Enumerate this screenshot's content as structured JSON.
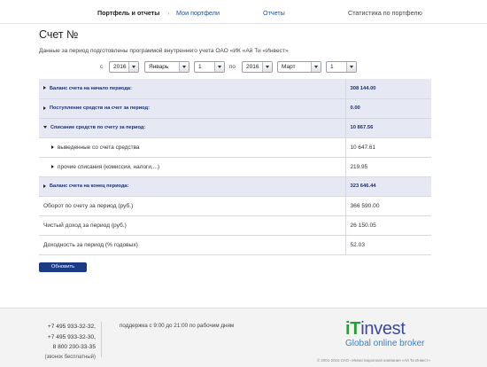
{
  "nav": {
    "active": "Портфель и отчеты",
    "separator": "›",
    "my_portfolios": "Мои портфели",
    "reports": "Отчеты",
    "stats": "Статистика по портфелю"
  },
  "page": {
    "title": "Счет №",
    "intro": "Данные за период подготовлены программой внутреннего учета ОАО «ИК «Ай Ти «Инвест»"
  },
  "period": {
    "from_label": "с",
    "to_label": "по",
    "from_year": "2016",
    "from_month": "Январь",
    "from_day": "1",
    "to_year": "2016",
    "to_month": "Март",
    "to_day": "1"
  },
  "report": {
    "rows": [
      {
        "label": "Баланс счета на начало периода:",
        "value": "308 144.00"
      },
      {
        "label": "Поступление средств на счет за период:",
        "value": "0.00"
      },
      {
        "label": "Списание средств по счету за период:",
        "value": "10 867.56"
      },
      {
        "label": "выведенные со счета средства",
        "value": "10 647.61"
      },
      {
        "label": "прочие списания (комиссии, налоги,...)",
        "value": "219.95"
      },
      {
        "label": "Баланс счета на конец периода:",
        "value": "323 646.44"
      },
      {
        "label": "Оборот по счету за период (руб.)",
        "value": "366 590.00"
      },
      {
        "label": "Чистый доход за период (руб.)",
        "value": "26 150.05"
      },
      {
        "label": "Доходность за период (% годовых)",
        "value": "52.03"
      }
    ]
  },
  "actions": {
    "refresh_label": "Обновить"
  },
  "footer": {
    "phone1": "+7 495 933-32-32,",
    "phone2": "+7 495 933-32-30,",
    "phone3": "8 800 200-33-35",
    "phone_note": "(звонок бесплатный)",
    "support": "поддержка с 9:00 до 21:00 по рабочим дням",
    "logo_prefix": "iT",
    "logo_rest": "invest",
    "tagline": "Global online broker",
    "copyright": "© 2001-2016 ОАО «Инвестиционная компания «Ай Ти Инвест»"
  },
  "colors": {
    "accent": "#1b3b84",
    "highlight_row": "#e6e9f4",
    "link": "#1a4e9e",
    "logo_green": "#2b9a3a",
    "logo_blue": "#3c4a9e"
  }
}
